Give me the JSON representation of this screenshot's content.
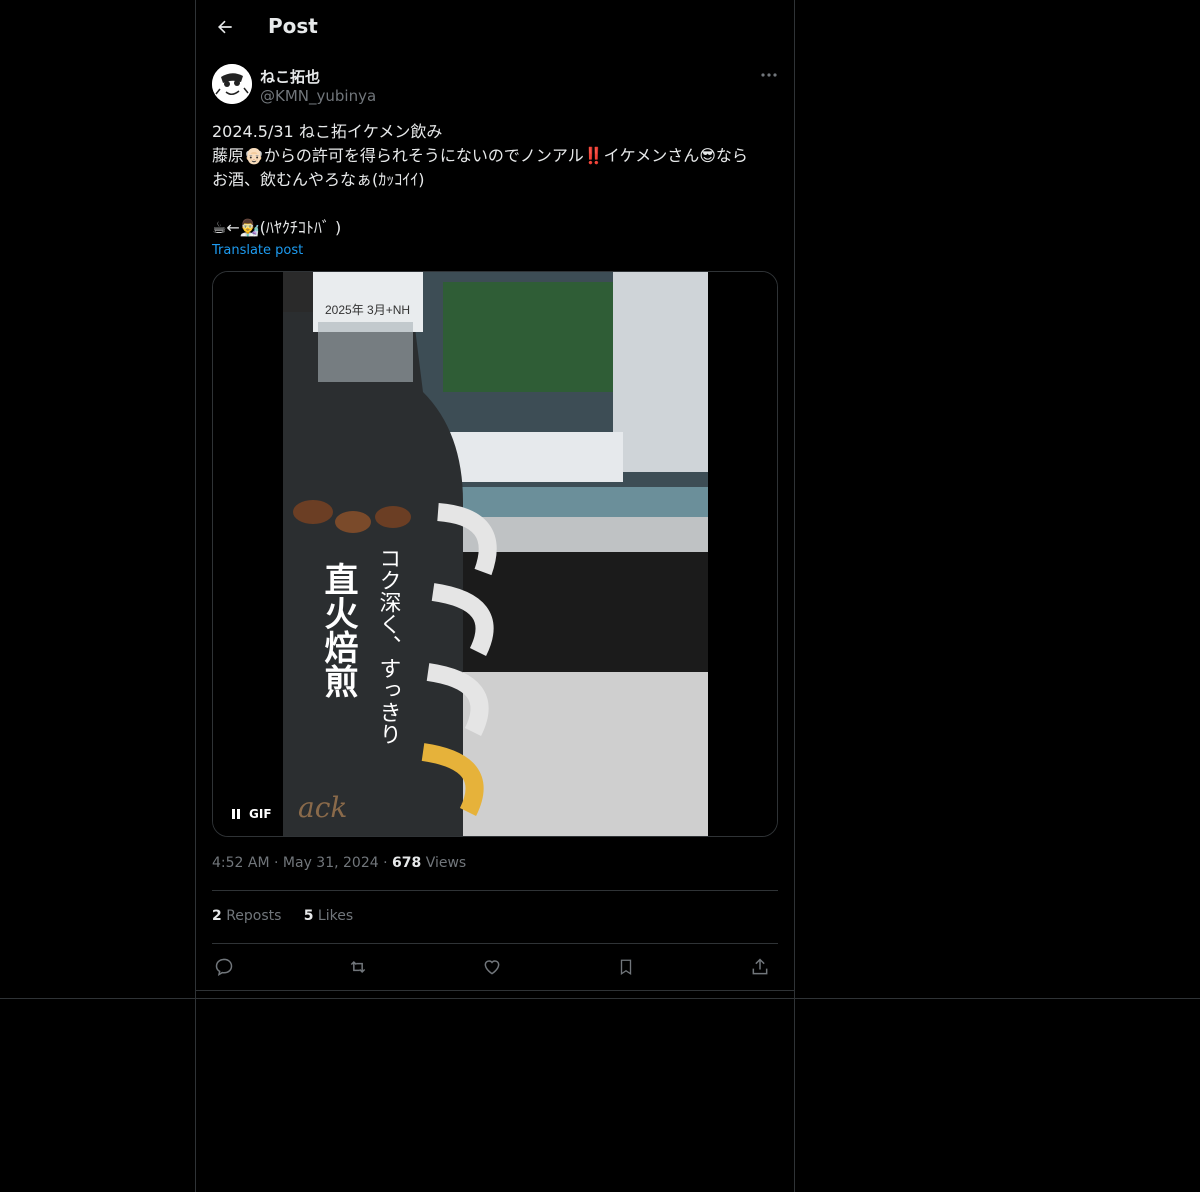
{
  "header": {
    "title": "Post"
  },
  "author": {
    "display_name": "ねこ拓也",
    "handle": "@KMN_yubinya"
  },
  "post": {
    "lines": [
      "2024.5/31 ねこ拓イケメン飲み",
      "藤原👴🏻からの許可を得られそうにないのでノンアル‼️イケメンさん😎なら",
      "お酒、飲むんやろなぁ(ｶｯｺｲｲ)",
      "",
      "☕←👨‍🔬(ﾊﾔｸﾁｺﾄﾊﾞ )"
    ],
    "translate_label": "Translate post"
  },
  "media": {
    "badge": "GIF",
    "bottle_text": {
      "date": "2025年 3月+NH",
      "tagline": "コク深く、すっきり",
      "main": "直火焙煎",
      "brand": "ack"
    }
  },
  "meta": {
    "time": "4:52 AM",
    "sep": "·",
    "date": "May 31, 2024",
    "views_count": "678",
    "views_label": "Views"
  },
  "stats": {
    "reposts_count": "2",
    "reposts_label": "Reposts",
    "likes_count": "5",
    "likes_label": "Likes"
  },
  "colors": {
    "background": "#000000",
    "text": "#e7e9ea",
    "muted": "#71767b",
    "link": "#1d9bf0",
    "border": "#2f3336"
  }
}
